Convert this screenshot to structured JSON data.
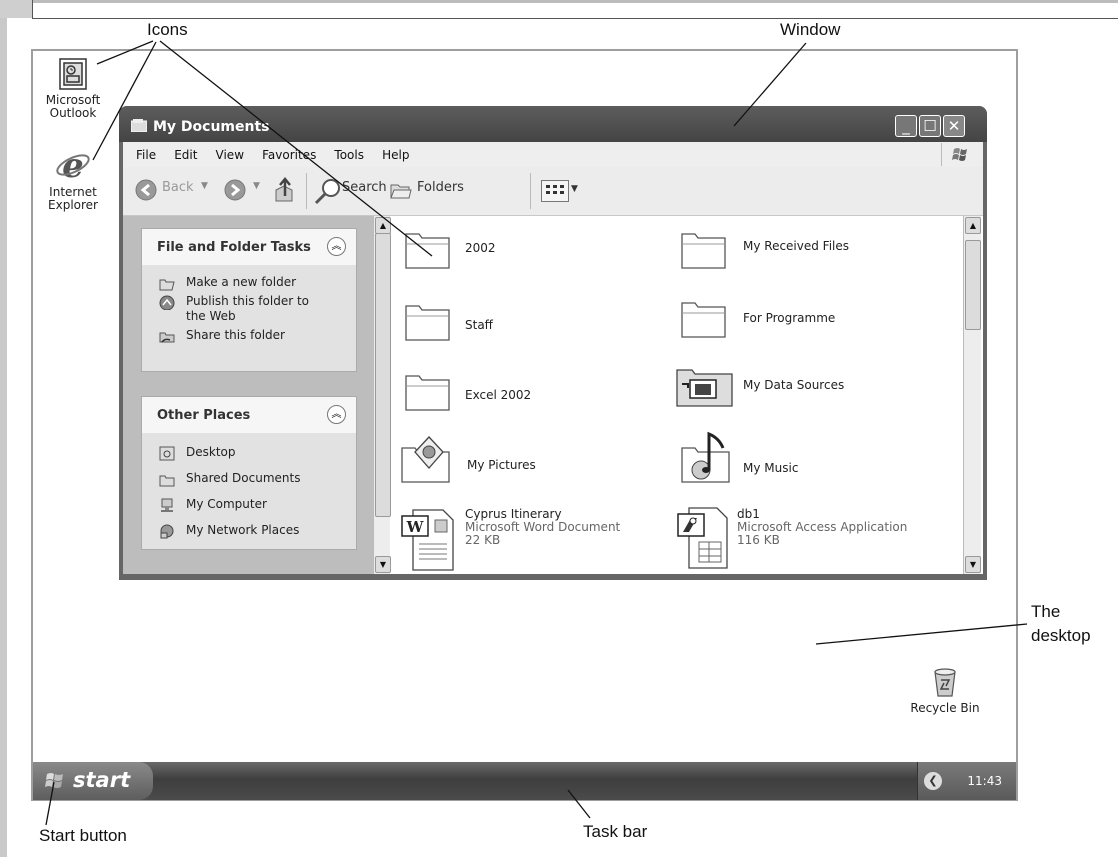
{
  "annotations": {
    "icons": "Icons",
    "window": "Window",
    "desktop_line1": "The",
    "desktop_line2": "desktop",
    "start_button": "Start button",
    "task_bar": "Task bar"
  },
  "desktop": {
    "outlook_line1": "Microsoft",
    "outlook_line2": "Outlook",
    "ie_line1": "Internet",
    "ie_line2": "Explorer",
    "recycle_bin": "Recycle Bin"
  },
  "window": {
    "title": "My Documents",
    "menu": [
      "File",
      "Edit",
      "View",
      "Favorites",
      "Tools",
      "Help"
    ],
    "toolbar": {
      "back": "Back",
      "search": "Search",
      "folders": "Folders"
    },
    "task_pane": {
      "file_tasks": {
        "title": "File and Folder Tasks",
        "items": [
          "Make a new folder",
          "Publish this folder to",
          "the Web",
          "Share this folder"
        ]
      },
      "other_places": {
        "title": "Other Places",
        "items": [
          "Desktop",
          "Shared Documents",
          "My Computer",
          "My Network Places"
        ]
      }
    },
    "files": [
      {
        "name": "2002"
      },
      {
        "name": "My Received Files"
      },
      {
        "name": "Staff"
      },
      {
        "name": "For Programme"
      },
      {
        "name": "Excel 2002"
      },
      {
        "name": "My Data Sources"
      },
      {
        "name": "My Pictures"
      },
      {
        "name": "My Music"
      },
      {
        "name": "Cyprus Itinerary",
        "type": "Microsoft Word Document",
        "size": "22 KB"
      },
      {
        "name": "db1",
        "type": "Microsoft Access Application",
        "size": "116 KB"
      }
    ]
  },
  "taskbar": {
    "start": "start",
    "clock": "11:43"
  },
  "icons": [
    "outlook-icon",
    "internet-explorer-icon",
    "recycle-bin-icon",
    "folder-icon",
    "word-document-icon",
    "access-database-icon",
    "windows-flag-icon"
  ]
}
